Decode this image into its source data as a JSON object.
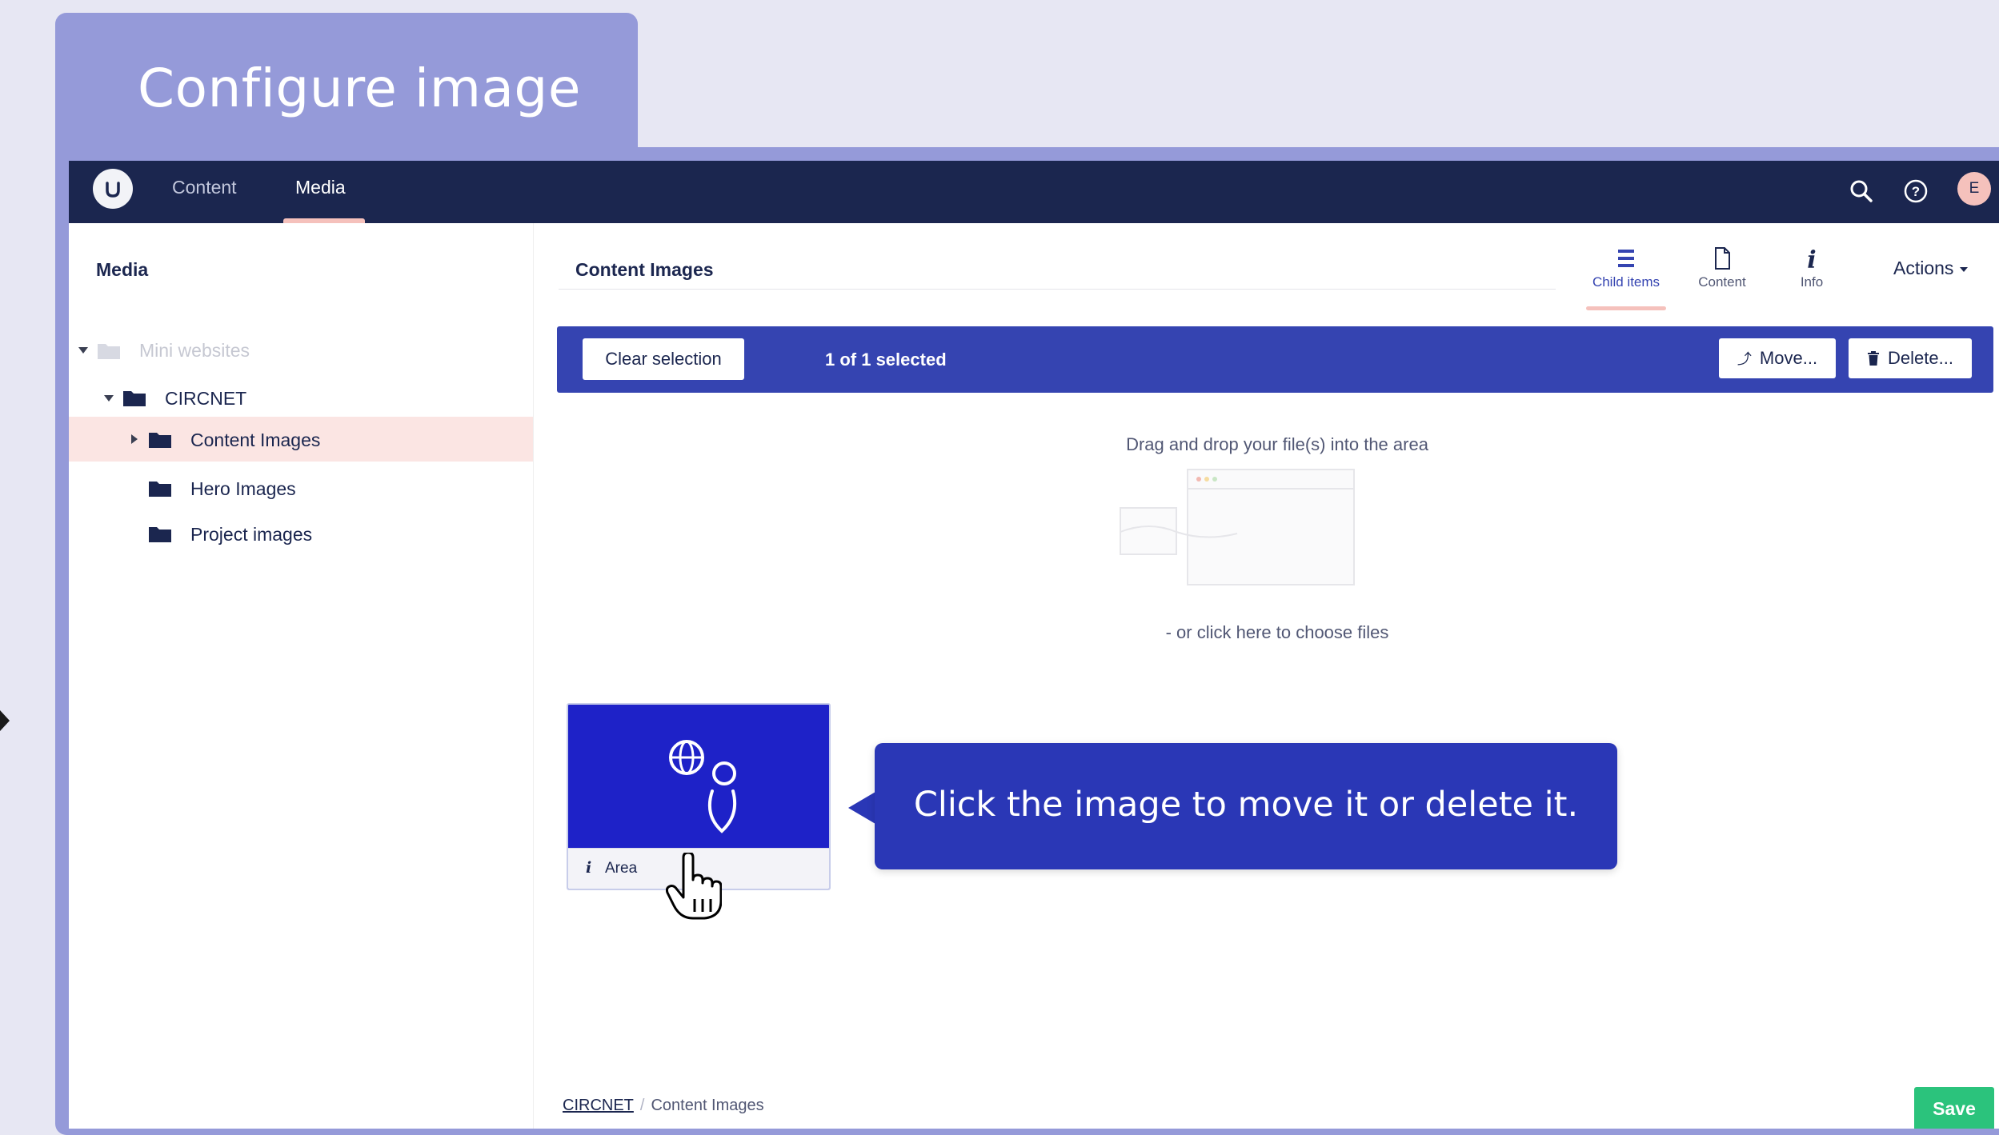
{
  "overlay": {
    "title": "Configure image",
    "callout": "Click the image to move it or delete it."
  },
  "topbar": {
    "nav": [
      "Content",
      "Media"
    ],
    "active_nav": "Media",
    "icons": [
      "search-icon",
      "help-icon"
    ],
    "avatar_initial": "E"
  },
  "sidebar": {
    "title": "Media",
    "tree": [
      {
        "label": "Mini websites",
        "faded": true
      },
      {
        "label": "CIRCNET"
      },
      {
        "label": "Content Images",
        "selected": true
      },
      {
        "label": "Hero Images"
      },
      {
        "label": "Project images"
      }
    ]
  },
  "header": {
    "title": "Content Images",
    "tabs": [
      {
        "label": "Child items",
        "icon": "list-icon",
        "active": true
      },
      {
        "label": "Content",
        "icon": "document-icon"
      },
      {
        "label": "Info",
        "icon": "info-icon"
      }
    ],
    "actions_label": "Actions"
  },
  "selection_bar": {
    "clear_label": "Clear selection",
    "count_text": "1 of 1 selected",
    "move_label": "Move...",
    "delete_label": "Delete..."
  },
  "dropzone": {
    "prompt": "Drag and drop your file(s) into the area",
    "choose": "- or click here to choose files"
  },
  "media_items": [
    {
      "label": "Area"
    }
  ],
  "footer": {
    "breadcrumb": [
      "CIRCNET",
      "Content Images"
    ],
    "save_label": "Save"
  },
  "colors": {
    "overlay_purple": "#959ad9",
    "topbar": "#1b264f",
    "primary_blue": "#3544b1",
    "accent_pink": "#f5c1bc",
    "save_green": "#2bc37c"
  }
}
